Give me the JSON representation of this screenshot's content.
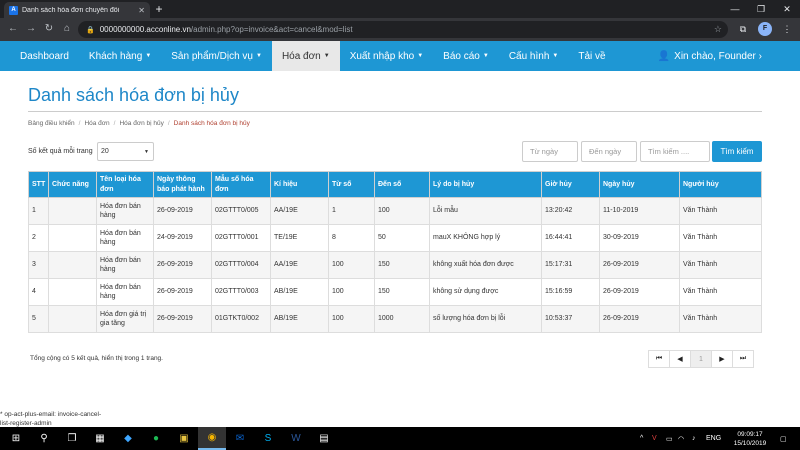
{
  "browser": {
    "tab_title": "Danh sách hóa đơn chuyển đổi",
    "tab_favicon": "A",
    "url_host": "0000000000.acconline.vn",
    "url_path": "/admin.php?op=invoice&act=cancel&mod=list",
    "profile_initial": "F"
  },
  "nav": {
    "items": [
      {
        "label": "Dashboard",
        "has_caret": false
      },
      {
        "label": "Khách hàng",
        "has_caret": true
      },
      {
        "label": "Sản phẩm/Dịch vụ",
        "has_caret": true
      },
      {
        "label": "Hóa đơn",
        "has_caret": true,
        "active": true
      },
      {
        "label": "Xuất nhập kho",
        "has_caret": true
      },
      {
        "label": "Báo cáo",
        "has_caret": true
      },
      {
        "label": "Cấu hình",
        "has_caret": true
      },
      {
        "label": "Tải về",
        "has_caret": false
      }
    ],
    "user_greeting": "Xin chào, Founder",
    "user_chevron": "›",
    "accent_color": "#1e97d4"
  },
  "page": {
    "title": "Danh sách hóa đơn bị hủy",
    "breadcrumb": [
      "Bảng điều khiển",
      "Hóa đơn",
      "Hóa đơn bị hủy",
      "Danh sách hóa đơn bị hủy"
    ]
  },
  "filters": {
    "page_size_label": "Số kết quả mỗi trang",
    "page_size_value": "20",
    "from_date_placeholder": "Từ ngày",
    "to_date_placeholder": "Đến ngày",
    "keyword_placeholder": "Tìm kiếm ....",
    "search_button": "Tìm kiếm"
  },
  "table": {
    "columns": [
      "STT",
      "Chức năng",
      "Tên loại hóa đơn",
      "Ngày thông báo phát hành",
      "Mẫu số hóa đơn",
      "Kí hiệu",
      "Từ số",
      "Đến số",
      "Lý do bị hủy",
      "Giờ hủy",
      "Ngày hủy",
      "Người hủy"
    ],
    "rows": [
      [
        "1",
        "",
        "Hóa đơn bán hàng",
        "26-09-2019",
        "02GTTT0/005",
        "AA/19E",
        "1",
        "100",
        "Lỗi mẫu",
        "13:20:42",
        "11-10-2019",
        "Văn Thành"
      ],
      [
        "2",
        "",
        "Hóa đơn bán hàng",
        "24-09-2019",
        "02GTTT0/001",
        "TE/19E",
        "8",
        "50",
        "mauX KHÔNG hợp lý",
        "16:44:41",
        "30-09-2019",
        "Văn Thành"
      ],
      [
        "3",
        "",
        "Hóa đơn bán hàng",
        "26-09-2019",
        "02GTTT0/004",
        "AA/19E",
        "100",
        "150",
        "không xuất hóa đơn được",
        "15:17:31",
        "26-09-2019",
        "Văn Thành"
      ],
      [
        "4",
        "",
        "Hóa đơn bán hàng",
        "26-09-2019",
        "02GTTT0/003",
        "AB/19E",
        "100",
        "150",
        "không sử dụng được",
        "15:16:59",
        "26-09-2019",
        "Văn Thành"
      ],
      [
        "5",
        "",
        "Hóa đơn giá trị gia tăng",
        "26-09-2019",
        "01GTKT0/002",
        "AB/19E",
        "100",
        "1000",
        "số lượng hóa đơn bị lỗi",
        "10:53:37",
        "26-09-2019",
        "Văn Thành"
      ]
    ]
  },
  "footer": {
    "summary": "Tổng cộng có 5 kết quả, hiển thị trong 1 trang.",
    "pager": {
      "first": "⏮",
      "prev": "◀",
      "current": "1",
      "next": "▶",
      "last": "⏭"
    }
  },
  "status": {
    "line1": "* op-act-plus-email: invoice-cancel-",
    "line2": "list-register-admin"
  },
  "taskbar": {
    "language": "ENG",
    "time": "09:09:17",
    "date": "15/10/2019"
  }
}
